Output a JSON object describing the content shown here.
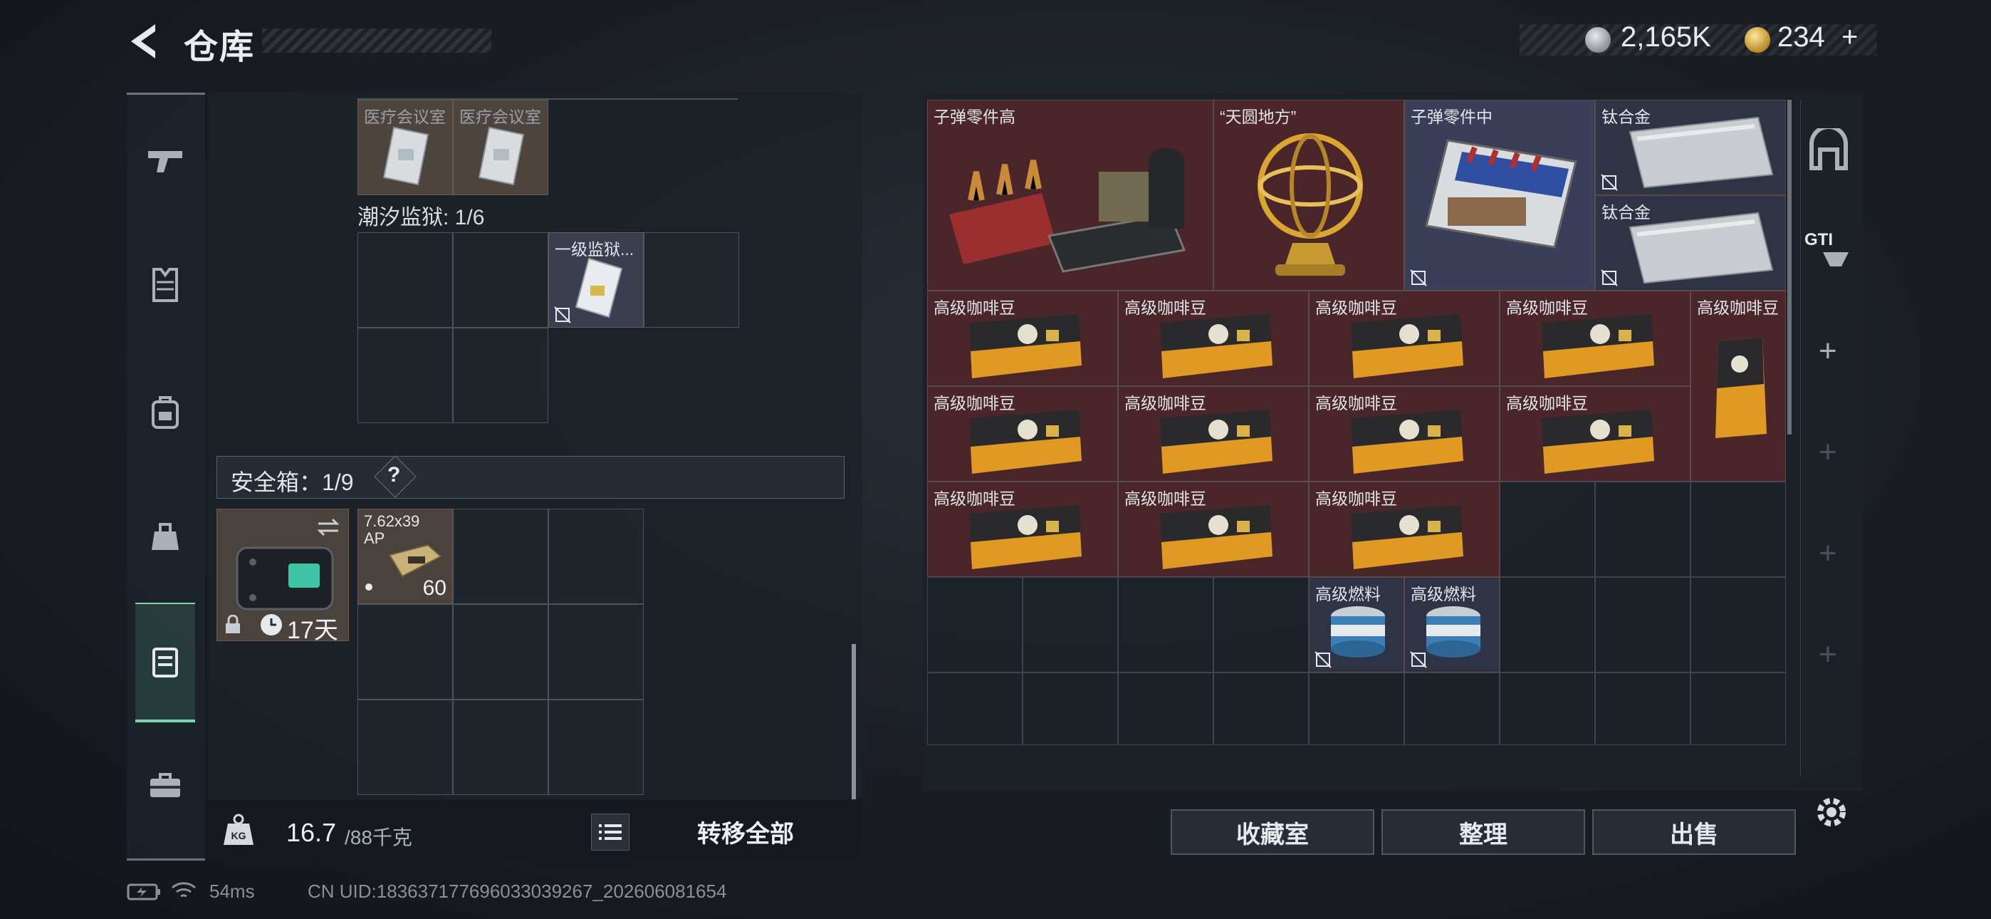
{
  "header": {
    "title": "仓库"
  },
  "currency": {
    "silver": "2,165K",
    "gold": "234",
    "gold_plus": "+"
  },
  "left": {
    "top_items": [
      {
        "label": "医疗会议室"
      },
      {
        "label": "医疗会议室"
      }
    ],
    "prison_label": "潮汐监狱: 1/6",
    "prison_item": {
      "label": "一级监狱..."
    },
    "safebox_label": "安全箱：1/9",
    "safebox_help": "?",
    "safebox_timer": "17天",
    "ammo": {
      "label_line1": "7.62x39",
      "label_line2": "AP",
      "count": "60"
    },
    "weight": {
      "current": "16.7",
      "max": "/88千克"
    },
    "transfer_all": "转移全部"
  },
  "right": {
    "items": {
      "bullet_parts_high": "子弹零件高",
      "tianyuan": "“天圆地方”",
      "bullet_parts_mid": "子弹零件中",
      "titanium": "钛合金",
      "coffee": "高级咖啡豆",
      "fuel": "高级燃料"
    },
    "buttons": {
      "collection": "收藏室",
      "sort": "整理",
      "sell": "出售"
    }
  },
  "footer": {
    "ping": "54ms",
    "uid": "CN UID:183637177696033039267_202606081654"
  },
  "colors": {
    "accent": "#7fd4b0",
    "item_red": "#4a2529",
    "item_blue": "#3a3e58"
  }
}
